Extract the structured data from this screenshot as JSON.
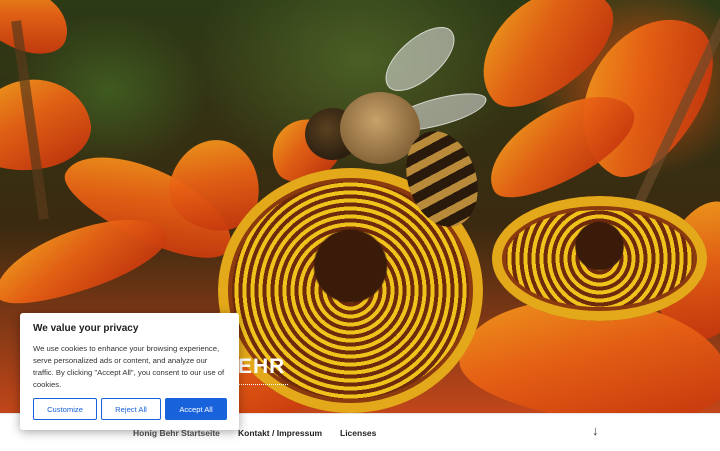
{
  "hero": {
    "title_visible": "EHR"
  },
  "nav": {
    "items": [
      {
        "label": "Honig Behr Startseite"
      },
      {
        "label": "Kontakt / Impressum"
      },
      {
        "label": "Licenses"
      }
    ],
    "scroll_icon": "arrow-down-icon"
  },
  "cookie": {
    "title": "We value your privacy",
    "body": "We use cookies to enhance your browsing experience, serve personalized ads or content, and analyze our traffic. By clicking \"Accept All\", you consent to our use of cookies.",
    "customize_label": "Customize",
    "reject_label": "Reject All",
    "accept_label": "Accept All",
    "accent_color": "#1863dc"
  }
}
